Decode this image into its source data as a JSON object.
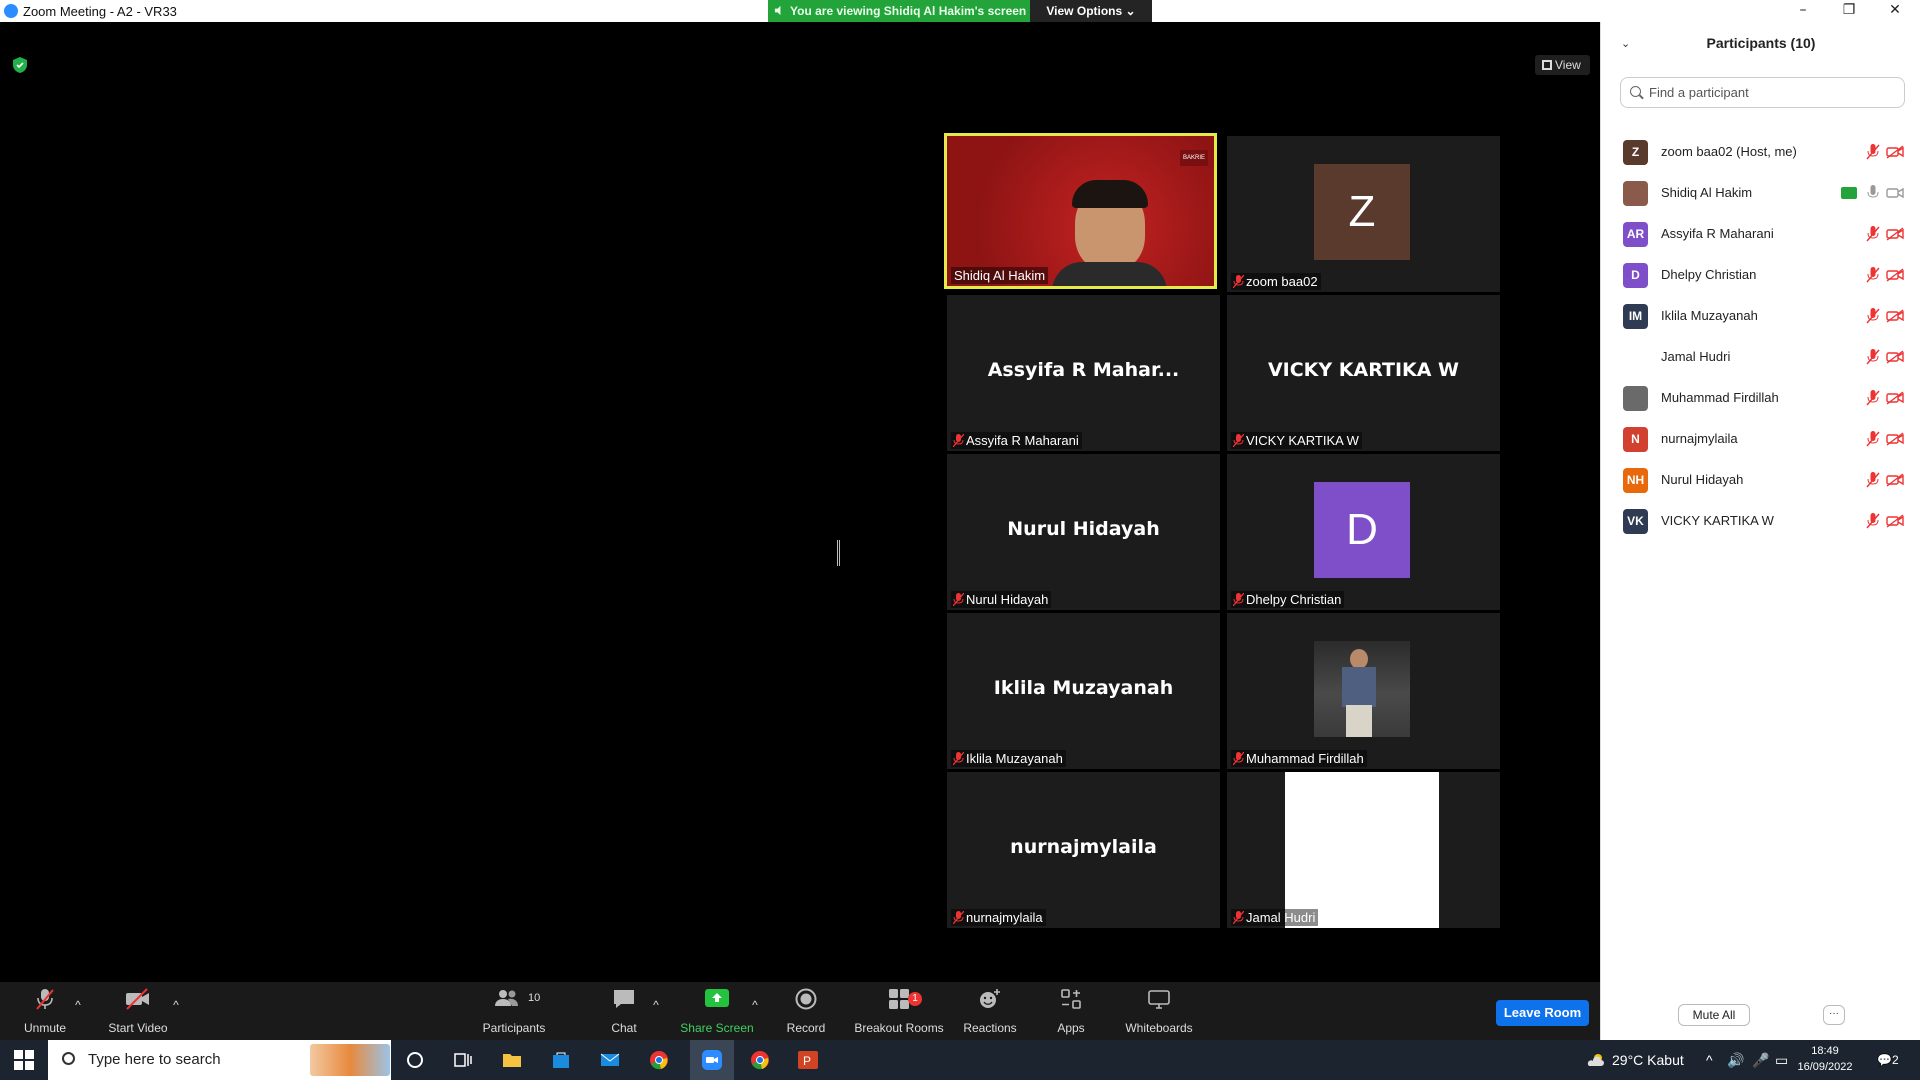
{
  "window": {
    "title": "Zoom Meeting - A2 - VR33"
  },
  "share_banner": {
    "text": "You are viewing Shidiq Al Hakim's screen",
    "view_options": "View Options"
  },
  "view_button": "View",
  "tiles": [
    {
      "caption": "Shidiq Al Hakim",
      "big": "",
      "avatar": "",
      "active": true
    },
    {
      "caption": "zoom baa02",
      "big": "",
      "avatar": "Z",
      "avatar_color": "#5b3a2e"
    },
    {
      "caption": "Assyifa R Maharani",
      "big": "Assyifa R Mahar..."
    },
    {
      "caption": "VICKY KARTIKA W",
      "big": "VICKY KARTIKA W"
    },
    {
      "caption": "Nurul Hidayah",
      "big": "Nurul Hidayah"
    },
    {
      "caption": "Dhelpy Christian",
      "big": "",
      "avatar": "D",
      "avatar_color": "#7e4fc8"
    },
    {
      "caption": "Iklila Muzayanah",
      "big": "Iklila Muzayanah"
    },
    {
      "caption": "Muhammad Firdillah",
      "big": ""
    },
    {
      "caption": "nurnajmylaila",
      "big": "nurnajmylaila"
    },
    {
      "caption": "Jamal Hudri",
      "big": ""
    }
  ],
  "toolbar": {
    "unmute": "Unmute",
    "start_video": "Start Video",
    "participants": "Participants",
    "participants_count": "10",
    "chat": "Chat",
    "share_screen": "Share Screen",
    "record": "Record",
    "breakout_rooms": "Breakout Rooms",
    "breakout_badge": "1",
    "reactions": "Reactions",
    "apps": "Apps",
    "whiteboards": "Whiteboards",
    "leave_room": "Leave Room"
  },
  "panel": {
    "title": "Participants (10)",
    "search_placeholder": "Find a participant",
    "participants": [
      {
        "initials": "Z",
        "name": "zoom baa02 (Host, me)",
        "color": "#5b3a2e"
      },
      {
        "initials": "",
        "name": "Shidiq Al Hakim",
        "color": "#8a5a4a",
        "sharing": true
      },
      {
        "initials": "AR",
        "name": "Assyifa R Maharani",
        "color": "#7e4fc8"
      },
      {
        "initials": "D",
        "name": "Dhelpy Christian",
        "color": "#7e4fc8"
      },
      {
        "initials": "IM",
        "name": "Iklila Muzayanah",
        "color": "#2f3b52"
      },
      {
        "initials": "",
        "name": "Jamal Hudri",
        "color": "#ffffff"
      },
      {
        "initials": "",
        "name": "Muhammad Firdillah",
        "color": "#6a6a6a"
      },
      {
        "initials": "N",
        "name": "nurnajmylaila",
        "color": "#d2412f"
      },
      {
        "initials": "NH",
        "name": "Nurul Hidayah",
        "color": "#e8680c"
      },
      {
        "initials": "VK",
        "name": "VICKY KARTIKA W",
        "color": "#2f3b52"
      }
    ],
    "mute_all": "Mute All",
    "more": "···"
  },
  "taskbar": {
    "search_placeholder": "Type here to search",
    "weather": "29°C  Kabut",
    "time": "18:49",
    "date": "16/09/2022",
    "notif_count": "2"
  }
}
